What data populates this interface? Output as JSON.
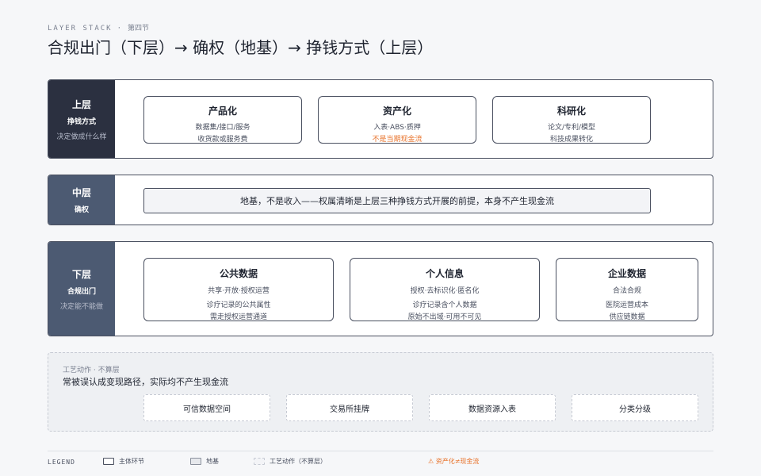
{
  "header": {
    "kicker": "LAYER STACK",
    "kicker_sep": "·",
    "kicker_sub": "第四节",
    "title": "合规出门（下层）→ 确权（地基）→ 挣钱方式（上层）"
  },
  "layers": {
    "top": {
      "level": "上层",
      "name": "挣钱方式",
      "desc": "决定做成什么样",
      "cards": [
        {
          "title": "产品化",
          "line1": "数据集/接口/服务",
          "line2": "收货款或服务费"
        },
        {
          "title": "资产化",
          "line1": "入表·ABS·质押",
          "line2": "不是当期现金流"
        },
        {
          "title": "科研化",
          "line1": "论文/专利/模型",
          "line2": "科技成果转化"
        }
      ]
    },
    "middle": {
      "level": "中层",
      "name": "确权",
      "foundation": "地基，不是收入——权属清晰是上层三种挣钱方式开展的前提，本身不产生现金流"
    },
    "bottom": {
      "level": "下层",
      "name": "合规出门",
      "desc": "决定能不能做",
      "cards": [
        {
          "title": "公共数据",
          "line1": "共享·开放·授权运营",
          "line2": "诊疗记录的公共属性",
          "line3": "需走授权运营通道"
        },
        {
          "title": "个人信息",
          "line1": "授权·去标识化·匿名化",
          "line2": "诊疗记录含个人数据",
          "line3": "原始不出域·可用不可见"
        },
        {
          "title": "企业数据",
          "line1": "合法合规",
          "line2": "医院运营成本",
          "line3": "供应链数据"
        }
      ]
    }
  },
  "craft": {
    "heading": "工艺动作 · 不算层",
    "subtitle": "常被误认成变现路径，实际均不产生现金流",
    "items": [
      "可信数据空间",
      "交易所挂牌",
      "数据资源入表",
      "分类分级"
    ]
  },
  "legend": {
    "title": "LEGEND",
    "main": "主体环节",
    "foundation": "地基",
    "craft": "工艺动作（不算层）",
    "warning": "⚠ 资产化≠现金流"
  },
  "colors": {
    "dark_label": "#2b3040",
    "slate_label": "#4c5a72",
    "warning": "#e8722a",
    "border": "#4a5060"
  }
}
